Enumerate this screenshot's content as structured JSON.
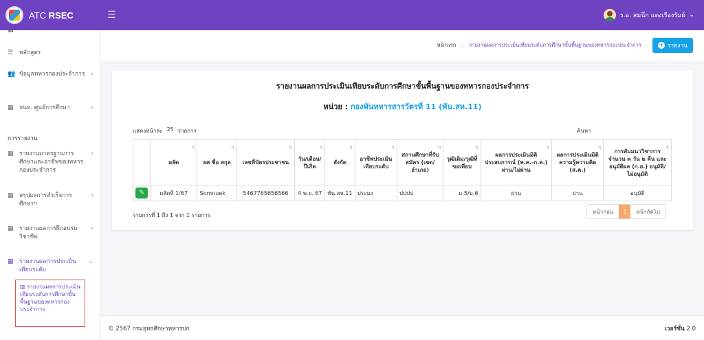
{
  "app": {
    "brand_prefix": "ATC",
    "brand_bold": "RSEC",
    "user": "ร.อ. สมนึก แดงเรืองรัมย์"
  },
  "sidebar": {
    "items": [
      {
        "label": "หลักสูตร",
        "icon": "list-icon"
      },
      {
        "label": "ข้อมูลทหารกองประจำการ",
        "icon": "users-icon"
      },
      {
        "label": "จนท. ศูนย์การศึกษา",
        "icon": "grid-icon"
      }
    ],
    "report_header": "การรายงาน",
    "reports": [
      {
        "label": "รายงานมาตรฐานการศึกษาและอาชีพของทหารกองประจำการ"
      },
      {
        "label": "สรุปผลการสำเร็จการศึกษาฯ"
      },
      {
        "label": "รายงานผลการฝึกอบรมวิชาชีพ"
      },
      {
        "label": "รายงานผลการประเมินเทียบระดับ"
      }
    ],
    "sub_active": "รายงานผลการประเมินเทียบระดับการศึกษาขั้นพื้นฐานของทหารกองประจำการ"
  },
  "breadcrumb": {
    "home": "หน้าแรก",
    "current": "รายงานผลการประเมินเทียบระดับการศึกษาขั้นพื้นฐานของทหารกองประจำการ"
  },
  "report_button": "รายงาน",
  "card": {
    "title": "รายงานผลการประเมินเทียบระดับการศึกษาขั้นพื้นฐานของทหารกองประจำการ",
    "unit_label": "หน่วย :",
    "unit_value": "กองพันทหารสารวัตรที่ 11 (พัน.สห.11)",
    "show_label": "แสดงหน้าละ",
    "page_size": "25",
    "show_suffix": "รายการ",
    "search_label": "ค้นหา",
    "columns": [
      "ผลัด",
      "ยศ ชื่อ สกุล",
      "เลขที่บัตรประชาชน",
      "วัน/เดือน/ปีเกิด",
      "สังกัด",
      "อาชีพประเมินเทียบระดับ",
      "สถานศึกษาที่รับสมัคร (เขต/อำเภอ)",
      "วุฒิเดิม/วุฒิที่ขอเทียบ",
      "ผลการประเมินมิติประสบการณ์ (พ.ค.-ก.ค.) ผ่าน/ไม่ผ่าน",
      "ผลการประเมินมิติความรู้ความคิด (ส.ค.)",
      "การสัมมนาวิชาการจำนวน ๓ วัน ๒ คืน และอนุมัติผล (ก.ย.) อนุมัติ/ไม่อนุมัติ"
    ],
    "rows": [
      [
        "ผลัดที่ 1/67",
        "Somnuek",
        "5467765656566",
        "4 พ.ย. 67",
        "พัน.สห.11",
        "ประมง",
        "ปปปป",
        "ม.5/ม.6",
        "ผ่าน",
        "ผ่าน",
        "อนุมัติ"
      ]
    ],
    "info": "รายการที่ 1 ถึง 1 จาก 1 รายการ",
    "pager": {
      "prev": "หน้าก่อน",
      "current": "1",
      "next": "หน้าถัดไป"
    }
  },
  "footer": {
    "copyright": "© 2567 กรมยุทธศึกษาทหารบก",
    "version_label": "เวอร์ชั่น",
    "version": "2.0"
  }
}
